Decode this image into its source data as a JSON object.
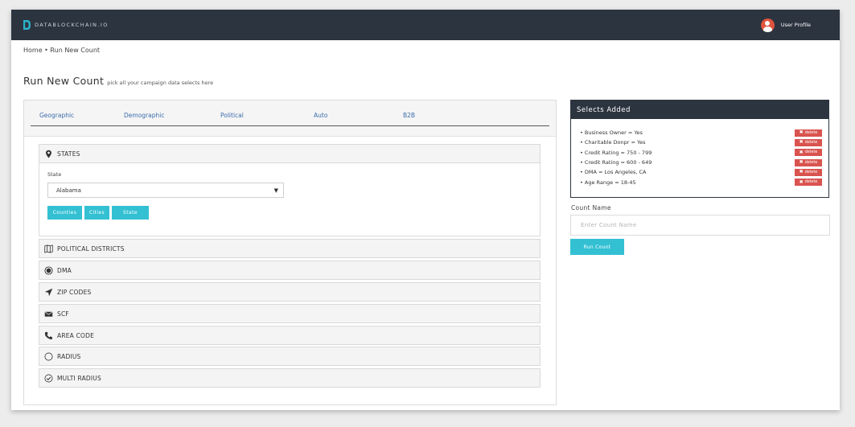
{
  "navbar": {
    "brand": "DATABLOCKCHAIN.IO",
    "profile_label": "User Profile"
  },
  "breadcrumb": "Home • Run New Count",
  "page": {
    "title": "Run New Count",
    "subtitle": "pick all your campaign data selects here"
  },
  "tabs": [
    {
      "label": "Geographic"
    },
    {
      "label": "Demographic"
    },
    {
      "label": "Political"
    },
    {
      "label": "Auto"
    },
    {
      "label": "B2B"
    }
  ],
  "states_section": {
    "title": "STATES",
    "field_label": "State",
    "selected_value": "Alabama",
    "buttons": [
      "Counties",
      "Cities",
      "State"
    ]
  },
  "sections": [
    {
      "label": "POLITICAL DISTRICTS",
      "icon": "map-icon"
    },
    {
      "label": "DMA",
      "icon": "target-icon"
    },
    {
      "label": "ZIP CODES",
      "icon": "location-arrow-icon"
    },
    {
      "label": "SCF",
      "icon": "envelope-icon"
    },
    {
      "label": "AREA CODE",
      "icon": "phone-icon"
    },
    {
      "label": "RADIUS",
      "icon": "circle-icon"
    },
    {
      "label": "MULTI RADIUS",
      "icon": "check-circle-icon"
    }
  ],
  "selects_panel": {
    "title": "Selects Added",
    "delete_label": "delete",
    "items": [
      "• Business Owner = Yes",
      "• Charitable Donpr = Yes",
      "• Credit Rating = 750 - 799",
      "• Credit Rating = 600 - 649",
      "• DMA = Los Angeles, CA",
      "• Age Range = 18-45"
    ]
  },
  "count_form": {
    "label": "Count Name",
    "placeholder": "Enter Count Name",
    "value": "",
    "button_label": "Run Count"
  },
  "colors": {
    "navbar": "#2c3440",
    "accent_teal": "#33c0d3",
    "delete_red": "#d9534f",
    "tab_link": "#3b6dab",
    "avatar": "#e0533c"
  }
}
